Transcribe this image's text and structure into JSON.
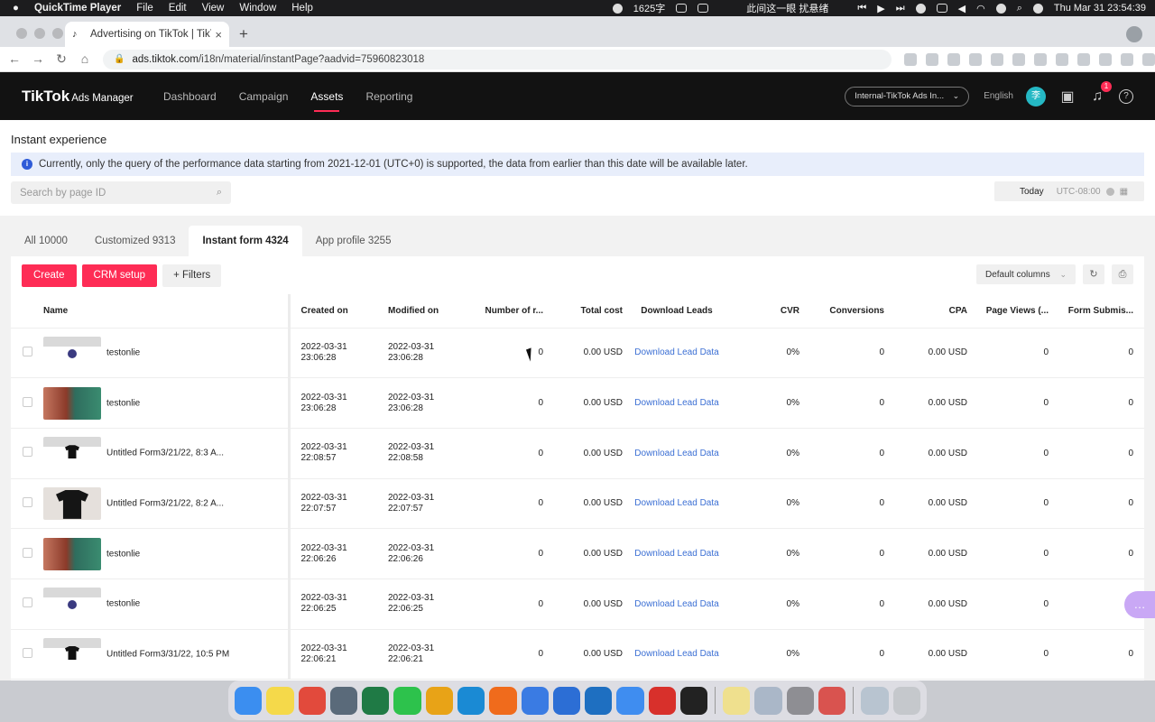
{
  "menubar": {
    "apple": "",
    "app_name": "QuickTime Player",
    "menus": [
      "File",
      "Edit",
      "View",
      "Window",
      "Help"
    ],
    "char_count": "1625字",
    "chinese_note": "此间这一眼 扰悬绪",
    "clock": "Thu Mar 31  23:54:39"
  },
  "browser": {
    "tab_title": "Advertising on TikTok | TikTok",
    "tab_close": "×",
    "new_tab": "+",
    "url_host": "ads.tiktok.com",
    "url_path": "/i18n/material/instantPage?aadvid=75960823018",
    "nav": {
      "back": "←",
      "forward": "→",
      "reload": "↻",
      "home": "⌂"
    }
  },
  "header": {
    "logo": "TikTok",
    "logo_sub": "Ads Manager",
    "nav": [
      {
        "label": "Dashboard",
        "active": false
      },
      {
        "label": "Campaign",
        "active": false
      },
      {
        "label": "Assets",
        "active": true
      },
      {
        "label": "Reporting",
        "active": false
      }
    ],
    "account": "Internal-TikTok Ads In...",
    "language": "English",
    "avatar_initial": "李",
    "notifications": "1",
    "help": "?"
  },
  "page": {
    "title": "Instant experience",
    "notice": "Currently, only the query of the performance data starting from 2021-12-01 (UTC+0) is supported, the data from earlier than this date will be available later.",
    "search_placeholder": "Search by page ID",
    "date_label": "Today",
    "timezone": "UTC-08:00",
    "tabs": [
      {
        "label": "All 10000",
        "active": false
      },
      {
        "label": "Customized 9313",
        "active": false
      },
      {
        "label": "Instant form 4324",
        "active": true
      },
      {
        "label": "App profile 3255",
        "active": false
      }
    ],
    "buttons": {
      "create": "Create",
      "crm": "CRM setup",
      "filters": "+ Filters",
      "columns": "Default columns"
    }
  },
  "table": {
    "headers": [
      "Name",
      "Created on",
      "Modified on",
      "Number of r...",
      "Total cost",
      "Download Leads",
      "CVR",
      "Conversions",
      "CPA",
      "Page Views (...",
      "Form Submis..."
    ],
    "rows": [
      {
        "thumb": "form",
        "name": "testonlie",
        "created_date": "2022-03-31",
        "created_time": "23:06:28",
        "modified_date": "2022-03-31",
        "modified_time": "23:06:28",
        "records": "0",
        "cost": "0.00 USD",
        "download": "Download Lead Data",
        "cvr": "0%",
        "conversions": "0",
        "cpa": "0.00 USD",
        "views": "0",
        "submits": "0"
      },
      {
        "thumb": "photo",
        "name": "testonlie",
        "created_date": "2022-03-31",
        "created_time": "23:06:28",
        "modified_date": "2022-03-31",
        "modified_time": "23:06:28",
        "records": "0",
        "cost": "0.00 USD",
        "download": "Download Lead Data",
        "cvr": "0%",
        "conversions": "0",
        "cpa": "0.00 USD",
        "views": "0",
        "submits": "0"
      },
      {
        "thumb": "shirt",
        "name": "Untitled Form3/21/22, 8:3 A...",
        "created_date": "2022-03-31",
        "created_time": "22:08:57",
        "modified_date": "2022-03-31",
        "modified_time": "22:08:58",
        "records": "0",
        "cost": "0.00 USD",
        "download": "Download Lead Data",
        "cvr": "0%",
        "conversions": "0",
        "cpa": "0.00 USD",
        "views": "0",
        "submits": "0"
      },
      {
        "thumb": "tee",
        "name": "Untitled Form3/21/22, 8:2 A...",
        "created_date": "2022-03-31",
        "created_time": "22:07:57",
        "modified_date": "2022-03-31",
        "modified_time": "22:07:57",
        "records": "0",
        "cost": "0.00 USD",
        "download": "Download Lead Data",
        "cvr": "0%",
        "conversions": "0",
        "cpa": "0.00 USD",
        "views": "0",
        "submits": "0"
      },
      {
        "thumb": "photo",
        "name": "testonlie",
        "created_date": "2022-03-31",
        "created_time": "22:06:26",
        "modified_date": "2022-03-31",
        "modified_time": "22:06:26",
        "records": "0",
        "cost": "0.00 USD",
        "download": "Download Lead Data",
        "cvr": "0%",
        "conversions": "0",
        "cpa": "0.00 USD",
        "views": "0",
        "submits": "0"
      },
      {
        "thumb": "form",
        "name": "testonlie",
        "created_date": "2022-03-31",
        "created_time": "22:06:25",
        "modified_date": "2022-03-31",
        "modified_time": "22:06:25",
        "records": "0",
        "cost": "0.00 USD",
        "download": "Download Lead Data",
        "cvr": "0%",
        "conversions": "0",
        "cpa": "0.00 USD",
        "views": "0",
        "submits": "0"
      },
      {
        "thumb": "shirt",
        "name": "Untitled Form3/31/22, 10:5 PM",
        "created_date": "2022-03-31",
        "created_time": "22:06:21",
        "modified_date": "2022-03-31",
        "modified_time": "22:06:21",
        "records": "0",
        "cost": "0.00 USD",
        "download": "Download Lead Data",
        "cvr": "0%",
        "conversions": "0",
        "cpa": "0.00 USD",
        "views": "0",
        "submits": "0"
      }
    ]
  },
  "dock": {
    "apps": [
      {
        "name": "finder-icon",
        "color": "#3b8ef0"
      },
      {
        "name": "notes-icon",
        "color": "#f5d94a"
      },
      {
        "name": "maps-icon",
        "color": "#e24a3c"
      },
      {
        "name": "network-icon",
        "color": "#5a6a7a"
      },
      {
        "name": "excel-icon",
        "color": "#1f7a45"
      },
      {
        "name": "wechat-icon",
        "color": "#2dc24c"
      },
      {
        "name": "chrome-icon",
        "color": "#e8a317"
      },
      {
        "name": "edge-icon",
        "color": "#1a8ad4"
      },
      {
        "name": "firefox-icon",
        "color": "#f06b1c"
      },
      {
        "name": "navigator-icon",
        "color": "#3a7be3"
      },
      {
        "name": "mail-icon",
        "color": "#2c6ed5"
      },
      {
        "name": "vscode-icon",
        "color": "#1e6fc1"
      },
      {
        "name": "feishu-icon",
        "color": "#3f8df0"
      },
      {
        "name": "netease-icon",
        "color": "#d8302b"
      },
      {
        "name": "terminal-icon",
        "color": "#222222"
      },
      {
        "name": "stickies-icon",
        "color": "#efe08e"
      },
      {
        "name": "preview-icon",
        "color": "#aab7c8"
      },
      {
        "name": "settings-icon",
        "color": "#8e8e93"
      },
      {
        "name": "teams-icon",
        "color": "#d9534f"
      },
      {
        "name": "utility-icon",
        "color": "#b8c4d0"
      },
      {
        "name": "trash-icon",
        "color": "#c5c8cc"
      }
    ]
  }
}
